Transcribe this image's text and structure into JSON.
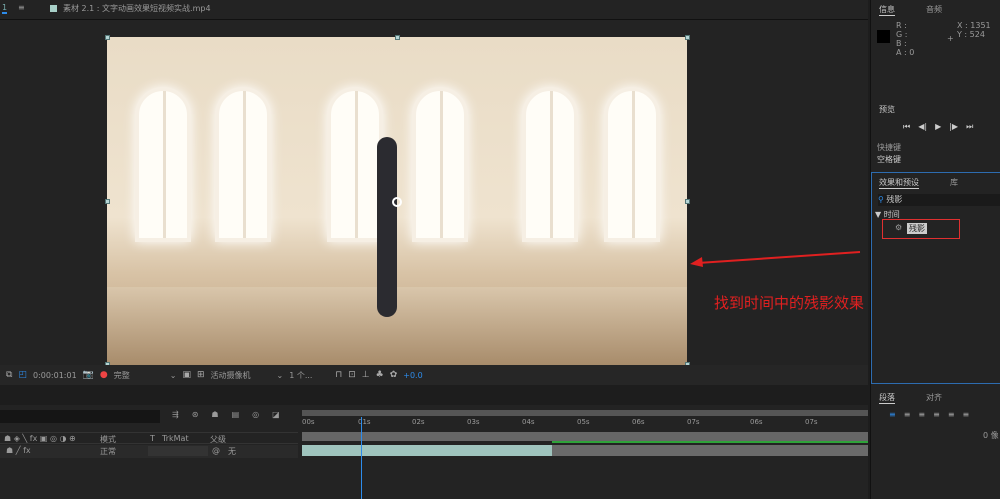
{
  "tabs": {
    "comp_tab": "1",
    "menu": "≡",
    "footage_tab": "素材 2.1 : 文字动画效果短视频实战.mp4"
  },
  "viewer_toolbar": {
    "timecode": "0:00:01:01",
    "resolution": "完整",
    "camera": "活动摄像机",
    "views": "1 个...",
    "exposure": "+0.0"
  },
  "timeline": {
    "columns": {
      "mode": "模式",
      "t": "T",
      "trkmat": "TrkMat",
      "parent": "父级"
    },
    "layer": {
      "mode": "正常",
      "parent": "无"
    },
    "ruler": [
      "00s",
      "01s",
      "02s",
      "03s",
      "04s",
      "05s",
      "06s",
      "07s",
      "06s",
      "07s"
    ],
    "playhead_s": 1.03
  },
  "info_panel": {
    "tab1": "信息",
    "tab2": "音频",
    "r": "R :",
    "g": "G :",
    "b": "B :",
    "a": "A : 0",
    "x": "X : 1351",
    "y": "Y : 524"
  },
  "preview_panel": {
    "title": "预览",
    "shortcut_label": "快捷键",
    "shortcut_value": "空格键"
  },
  "effects_panel": {
    "tab1": "效果和预设",
    "tab2": "库",
    "search": "残影",
    "category": "▼ 时间",
    "item": "残影"
  },
  "paragraph_panel": {
    "tab1": "段落",
    "tab2": "对齐",
    "indent": "0 像"
  },
  "annotation": "找到时间中的残影效果",
  "colors": {
    "accent": "#2d8ceb",
    "highlight": "#e03030",
    "layer_bar": "#9fc4bd",
    "work_area": "#2fa33a"
  }
}
